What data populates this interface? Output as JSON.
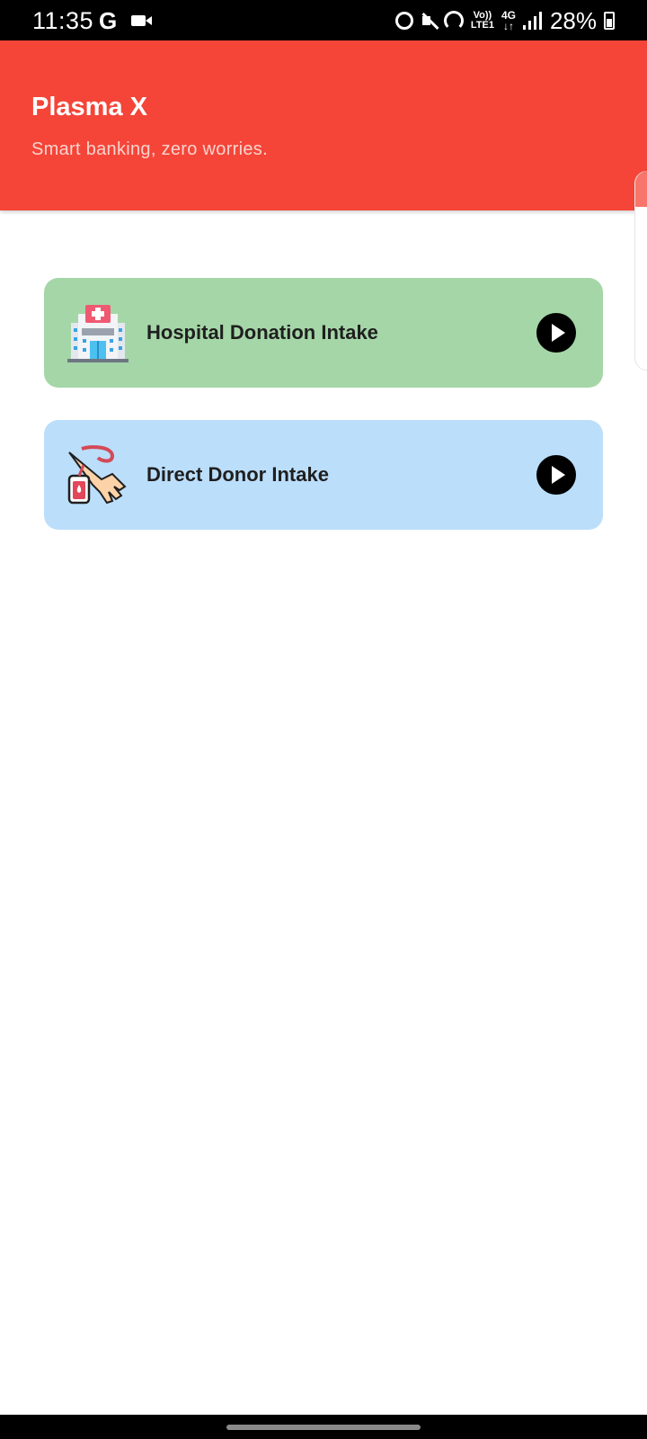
{
  "status_bar": {
    "time": "11:35",
    "google_label": "G",
    "network_top": "Vo))",
    "network_bottom": "LTE1",
    "data_type": "4G",
    "battery_percent": "28%"
  },
  "header": {
    "title": "Plasma X",
    "subtitle": "Smart banking, zero worries.",
    "background_color": "#f44538"
  },
  "cards": [
    {
      "label": "Hospital Donation Intake",
      "icon": "hospital-icon",
      "color": "#a5d6a7"
    },
    {
      "label": "Direct Donor Intake",
      "icon": "blood-donation-icon",
      "color": "#bbdefb"
    }
  ]
}
